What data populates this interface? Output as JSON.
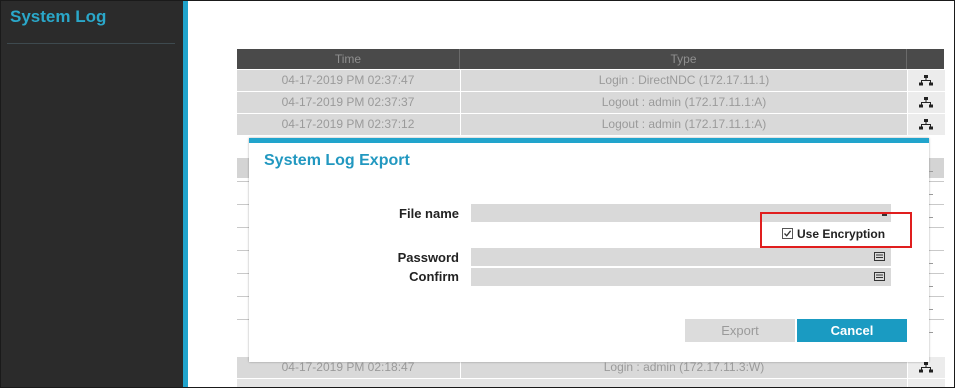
{
  "sidebar": {
    "title": "System Log"
  },
  "table": {
    "headers": {
      "time": "Time",
      "type": "Type"
    },
    "top_rows": [
      {
        "time": "04-17-2019  PM 02:37:47",
        "type": "Login : DirectNDC (172.17.11.1)",
        "icon": "network-icon"
      },
      {
        "time": "04-17-2019  PM 02:37:37",
        "type": "Logout : admin (172.17.11.1:A)",
        "icon": "network-icon"
      },
      {
        "time": "04-17-2019  PM 02:37:12",
        "type": "Logout : admin (172.17.11.1:A)",
        "icon": "network-icon"
      }
    ],
    "bottom_row": {
      "time": "04-17-2019  PM 02:18:47",
      "type": "Login : admin (172.17.11.3:W)",
      "icon": "network-icon"
    }
  },
  "dialog": {
    "title": "System Log Export",
    "file_name_label": "File name",
    "file_name_value": "",
    "use_encryption_label": "Use Encryption",
    "use_encryption_checked": true,
    "password_label": "Password",
    "password_value": "",
    "confirm_label": "Confirm",
    "confirm_value": "",
    "export_label": "Export",
    "cancel_label": "Cancel"
  },
  "colors": {
    "accent": "#21a4cc",
    "sidebar_bg": "#2b2b2b",
    "highlight": "#e01e1e"
  }
}
